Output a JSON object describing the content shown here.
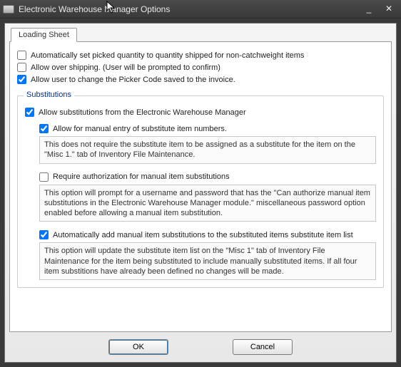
{
  "window": {
    "title": "Electronic Warehouse Manager Options",
    "minimize": "_",
    "close": "✕"
  },
  "tab": {
    "label": "Loading Sheet"
  },
  "checks": {
    "auto_qty": {
      "label": "Automatically set picked quantity to quantity shipped for non-catchweight items",
      "checked": false
    },
    "over_ship": {
      "label": "Allow over shipping. (User will be prompted to confirm)",
      "checked": false
    },
    "picker_code": {
      "label": "Allow user to change the Picker Code saved to the invoice.",
      "checked": true
    }
  },
  "subs": {
    "legend": "Substitutions",
    "allow": {
      "label": "Allow substitutions from the Electronic Warehouse Manager",
      "checked": true
    },
    "manual_entry": {
      "label": "Allow for manual entry of substitute item numbers.",
      "checked": true,
      "desc": "This does not require the substitute item to be assigned as a substitute for the item on the \"Misc 1.\" tab of Inventory File Maintenance."
    },
    "require_auth": {
      "label": "Require authorization for manual item substitutions",
      "checked": false,
      "desc": "This option will prompt for a username and password that has the \"Can authorize manual item substitutions in the Electronic Warehouse Manager module.\" miscellaneous password option enabled before allowing a manual item substitution."
    },
    "auto_add": {
      "label": "Automatically add manual item substitutions to the substituted items substitute item list",
      "checked": true,
      "desc": "This option will update the substitute item list on the \"Misc 1\" tab of Inventory File Maintenance for the item being substituted to include manually substituted items. If all four item substitions have already been defined no changes will be made."
    }
  },
  "buttons": {
    "ok": "OK",
    "cancel": "Cancel"
  }
}
